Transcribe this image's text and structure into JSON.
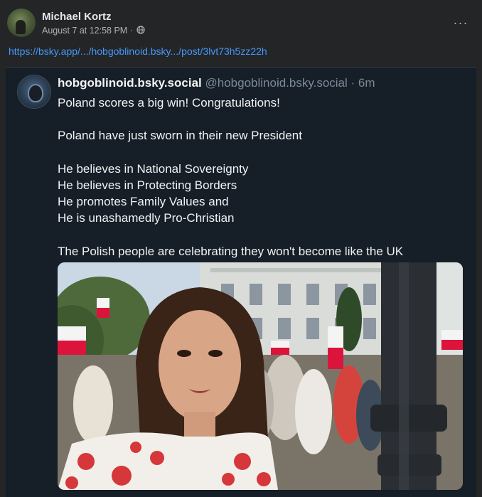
{
  "post": {
    "author_name": "Michael Kortz",
    "timestamp": "August 7 at 12:58 PM",
    "separator": "·",
    "privacy_icon": "globe-icon",
    "more_label": "···",
    "link": "https://bsky.app/.../hobgoblinoid.bsky.../post/3lvt73h5zz22h"
  },
  "embed": {
    "display_name": "hobgoblinoid.bsky.social",
    "handle": "@hobgoblinoid.bsky.social",
    "time": "· 6m",
    "lines": [
      "Poland scores a big win! Congratulations!",
      "",
      "Poland have just sworn in their new President",
      "",
      "He believes in National Sovereignty",
      "He believes in Protecting Borders",
      "He promotes Family Values and",
      "He is unashamedly Pro-Christian",
      "",
      "The Polish people are celebrating they won't become like the UK"
    ]
  },
  "colors": {
    "card_bg": "#242526",
    "embed_bg": "#161e27",
    "link": "#4599ff",
    "flag_white": "#f4f4f4",
    "flag_red": "#dc143c"
  }
}
